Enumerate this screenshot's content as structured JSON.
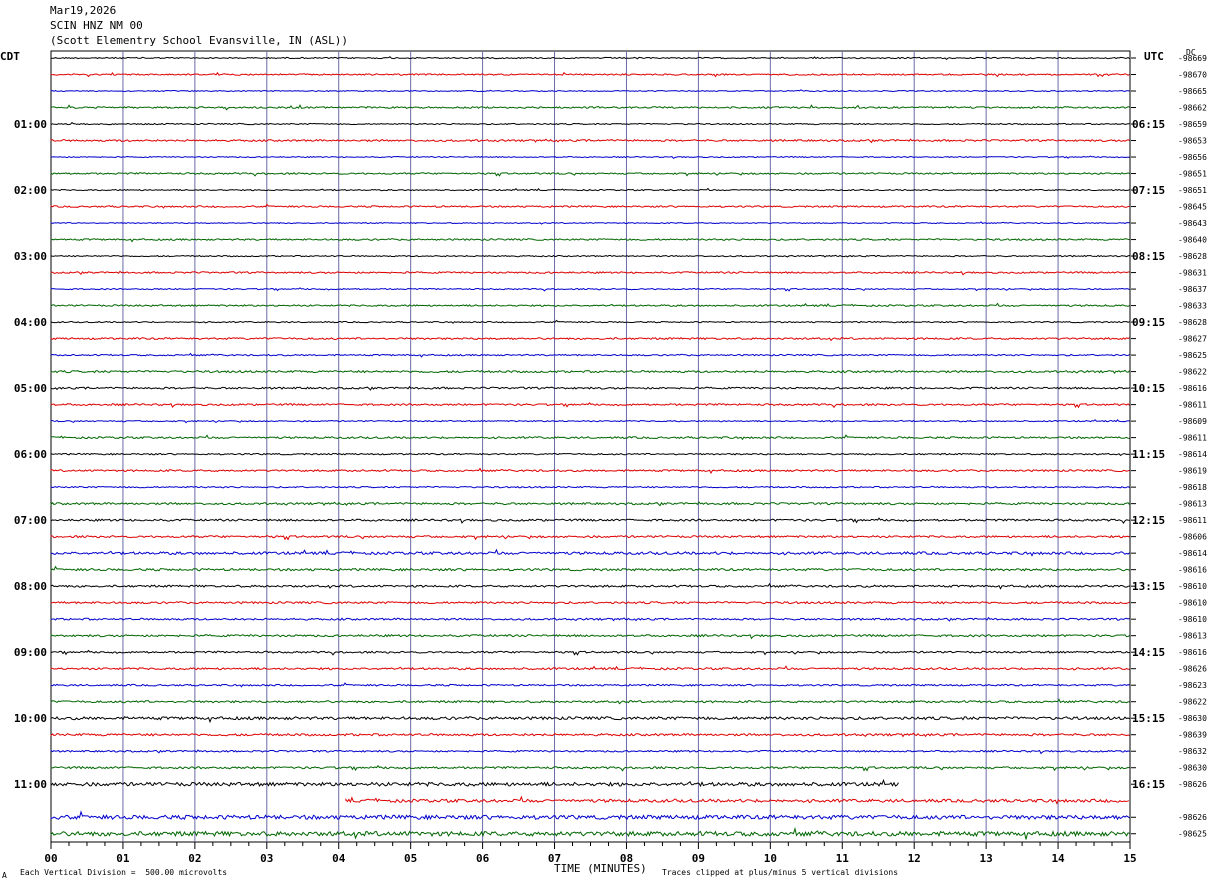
{
  "header": {
    "date": "Mar19,2026",
    "station": "SCIN HNZ NM 00",
    "location": "(Scott Elementry School Evansville, IN (ASL))"
  },
  "footer": {
    "left_mark": "A",
    "division": "Each Vertical Division =  500.00 microvolts",
    "clip_note": "Traces clipped at plus/minus 5 vertical divisions"
  },
  "chart_data": {
    "type": "line",
    "title": "",
    "xlabel": "TIME (MINUTES)",
    "left_axis_label": "CDT",
    "right_axis_label": "UTC",
    "dc_label": "DC",
    "xlim": [
      0,
      15
    ],
    "x_ticks": [
      "00",
      "01",
      "02",
      "03",
      "04",
      "05",
      "06",
      "07",
      "08",
      "09",
      "10",
      "11",
      "12",
      "13",
      "14",
      "15"
    ],
    "row_minutes": 15,
    "row_count": 48,
    "colors": [
      "#000000",
      "#dd0000",
      "#0000cc",
      "#006600"
    ],
    "left_hour_labels": [
      {
        "row": 4,
        "label": "01:00"
      },
      {
        "row": 8,
        "label": "02:00"
      },
      {
        "row": 12,
        "label": "03:00"
      },
      {
        "row": 16,
        "label": "04:00"
      },
      {
        "row": 20,
        "label": "05:00"
      },
      {
        "row": 24,
        "label": "06:00"
      },
      {
        "row": 28,
        "label": "07:00"
      },
      {
        "row": 32,
        "label": "08:00"
      },
      {
        "row": 36,
        "label": "09:00"
      },
      {
        "row": 40,
        "label": "10:00"
      },
      {
        "row": 44,
        "label": "11:00"
      }
    ],
    "right_hour_labels": [
      {
        "row": 4,
        "label": "06:15"
      },
      {
        "row": 8,
        "label": "07:15"
      },
      {
        "row": 12,
        "label": "08:15"
      },
      {
        "row": 16,
        "label": "09:15"
      },
      {
        "row": 20,
        "label": "10:15"
      },
      {
        "row": 24,
        "label": "11:15"
      },
      {
        "row": 28,
        "label": "12:15"
      },
      {
        "row": 32,
        "label": "13:15"
      },
      {
        "row": 36,
        "label": "14:15"
      },
      {
        "row": 40,
        "label": "15:15"
      },
      {
        "row": 44,
        "label": "16:15"
      }
    ],
    "dc_offsets": [
      "-98669",
      "-98670",
      "-98665",
      "-98662",
      "-98659",
      "-98653",
      "-98656",
      "-98651",
      "-98651",
      "-98645",
      "-98643",
      "-98640",
      "-98628",
      "-98631",
      "-98637",
      "-98633",
      "-98628",
      "-98627",
      "-98625",
      "-98622",
      "-98616",
      "-98611",
      "-98609",
      "-98611",
      "-98614",
      "-98619",
      "-98618",
      "-98613",
      "-98611",
      "-98606",
      "-98614",
      "-98616",
      "-98610",
      "-98610",
      "-98610",
      "-98613",
      "-98616",
      "-98626",
      "-98623",
      "-98622",
      "-98630",
      "-98639",
      "-98632",
      "-98630",
      "-98626",
      "",
      "-98626",
      "-98625"
    ],
    "trace_rows": [
      {
        "row": 0,
        "amp": 0.6,
        "x_end": 15
      },
      {
        "row": 1,
        "amp": 0.7,
        "x_end": 15
      },
      {
        "row": 2,
        "amp": 0.5,
        "x_end": 15
      },
      {
        "row": 3,
        "amp": 0.8,
        "x_end": 15
      },
      {
        "row": 4,
        "amp": 0.6,
        "x_end": 15
      },
      {
        "row": 5,
        "amp": 0.9,
        "x_end": 15
      },
      {
        "row": 6,
        "amp": 0.5,
        "x_end": 15
      },
      {
        "row": 7,
        "amp": 0.8,
        "x_end": 15
      },
      {
        "row": 8,
        "amp": 0.6,
        "x_end": 15
      },
      {
        "row": 9,
        "amp": 0.8,
        "x_end": 15
      },
      {
        "row": 10,
        "amp": 0.5,
        "x_end": 15
      },
      {
        "row": 11,
        "amp": 0.8,
        "x_end": 15
      },
      {
        "row": 12,
        "amp": 0.6,
        "x_end": 15
      },
      {
        "row": 13,
        "amp": 0.8,
        "x_end": 15
      },
      {
        "row": 14,
        "amp": 0.6,
        "x_end": 15
      },
      {
        "row": 15,
        "amp": 0.8,
        "x_end": 15
      },
      {
        "row": 16,
        "amp": 0.6,
        "x_end": 15
      },
      {
        "row": 17,
        "amp": 0.9,
        "x_end": 15
      },
      {
        "row": 18,
        "amp": 0.7,
        "x_end": 15
      },
      {
        "row": 19,
        "amp": 1.0,
        "x_end": 15
      },
      {
        "row": 20,
        "amp": 0.9,
        "x_end": 15
      },
      {
        "row": 21,
        "amp": 0.9,
        "x_end": 15
      },
      {
        "row": 22,
        "amp": 0.6,
        "x_end": 15
      },
      {
        "row": 23,
        "amp": 0.9,
        "x_end": 15
      },
      {
        "row": 24,
        "amp": 0.7,
        "x_end": 15
      },
      {
        "row": 25,
        "amp": 0.9,
        "x_end": 15
      },
      {
        "row": 26,
        "amp": 0.7,
        "x_end": 15
      },
      {
        "row": 27,
        "amp": 1.0,
        "x_end": 15
      },
      {
        "row": 28,
        "amp": 1.0,
        "x_end": 15
      },
      {
        "row": 29,
        "amp": 1.0,
        "x_end": 15
      },
      {
        "row": 30,
        "amp": 1.3,
        "x_end": 15
      },
      {
        "row": 31,
        "amp": 1.1,
        "x_end": 15
      },
      {
        "row": 32,
        "amp": 1.0,
        "x_end": 15
      },
      {
        "row": 33,
        "amp": 1.0,
        "x_end": 15
      },
      {
        "row": 34,
        "amp": 0.9,
        "x_end": 15
      },
      {
        "row": 35,
        "amp": 1.0,
        "x_end": 15
      },
      {
        "row": 36,
        "amp": 0.9,
        "x_end": 15
      },
      {
        "row": 37,
        "amp": 1.0,
        "x_end": 15
      },
      {
        "row": 38,
        "amp": 0.8,
        "x_end": 15
      },
      {
        "row": 39,
        "amp": 1.0,
        "x_end": 15
      },
      {
        "row": 40,
        "amp": 1.4,
        "x_end": 15
      },
      {
        "row": 41,
        "amp": 1.1,
        "x_end": 15
      },
      {
        "row": 42,
        "amp": 0.8,
        "x_end": 15
      },
      {
        "row": 43,
        "amp": 1.0,
        "x_end": 15
      },
      {
        "row": 44,
        "amp": 1.8,
        "x_end": 11.8
      },
      {
        "row": 45,
        "amp": 1.5,
        "x_start": 4.1,
        "x_end": 15
      },
      {
        "row": 46,
        "amp": 2.0,
        "x_end": 15
      },
      {
        "row": 47,
        "amp": 2.2,
        "x_end": 15
      }
    ]
  }
}
